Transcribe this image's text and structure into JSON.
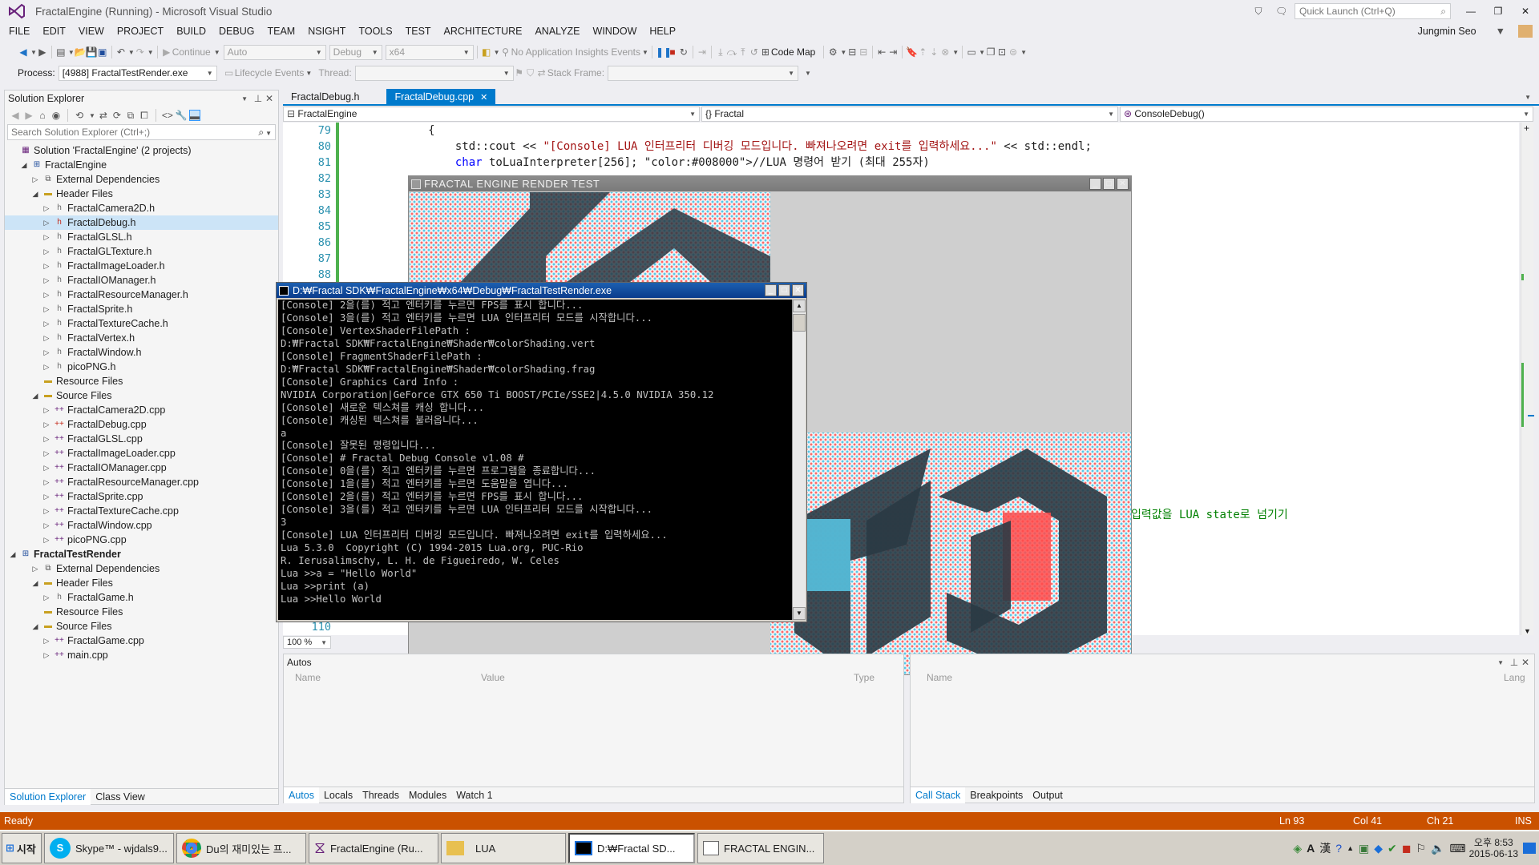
{
  "titlebar": {
    "title": "FractalEngine (Running) - Microsoft Visual Studio",
    "quick_launch": "Quick Launch (Ctrl+Q)",
    "user": "Jungmin Seo"
  },
  "menu": [
    "FILE",
    "EDIT",
    "VIEW",
    "PROJECT",
    "BUILD",
    "DEBUG",
    "TEAM",
    "NSIGHT",
    "TOOLS",
    "TEST",
    "ARCHITECTURE",
    "ANALYZE",
    "WINDOW",
    "HELP"
  ],
  "toolbar": {
    "continue": "Continue",
    "auto": "Auto",
    "config": "Debug",
    "platform": "x64",
    "insights": "No Application Insights Events",
    "code_map": "Code Map"
  },
  "toolbar2": {
    "process_label": "Process:",
    "process_value": "[4988] FractalTestRender.exe",
    "lifecycle": "Lifecycle Events",
    "thread_label": "Thread:",
    "stack_label": "Stack Frame:"
  },
  "solution_explorer": {
    "title": "Solution Explorer",
    "search_placeholder": "Search Solution Explorer (Ctrl+;)",
    "items": [
      {
        "t": "Solution 'FractalEngine' (2 projects)",
        "lvl": 0,
        "tri": "",
        "icon": "solution"
      },
      {
        "t": "FractalEngine",
        "lvl": 1,
        "tri": "◢",
        "icon": "project"
      },
      {
        "t": "External Dependencies",
        "lvl": 2,
        "tri": "▷",
        "icon": "deps"
      },
      {
        "t": "Header Files",
        "lvl": 2,
        "tri": "◢",
        "icon": "folder"
      },
      {
        "t": "FractalCamera2D.h",
        "lvl": 3,
        "tri": "▷",
        "icon": "h"
      },
      {
        "t": "FractalDebug.h",
        "lvl": 3,
        "tri": "▷",
        "icon": "h-edit",
        "sel": true
      },
      {
        "t": "FractalGLSL.h",
        "lvl": 3,
        "tri": "▷",
        "icon": "h"
      },
      {
        "t": "FractalGLTexture.h",
        "lvl": 3,
        "tri": "▷",
        "icon": "h"
      },
      {
        "t": "FractalImageLoader.h",
        "lvl": 3,
        "tri": "▷",
        "icon": "h"
      },
      {
        "t": "FractalIOManager.h",
        "lvl": 3,
        "tri": "▷",
        "icon": "h"
      },
      {
        "t": "FractalResourceManager.h",
        "lvl": 3,
        "tri": "▷",
        "icon": "h"
      },
      {
        "t": "FractalSprite.h",
        "lvl": 3,
        "tri": "▷",
        "icon": "h"
      },
      {
        "t": "FractalTextureCache.h",
        "lvl": 3,
        "tri": "▷",
        "icon": "h"
      },
      {
        "t": "FractalVertex.h",
        "lvl": 3,
        "tri": "▷",
        "icon": "h"
      },
      {
        "t": "FractalWindow.h",
        "lvl": 3,
        "tri": "▷",
        "icon": "h"
      },
      {
        "t": "picoPNG.h",
        "lvl": 3,
        "tri": "▷",
        "icon": "h"
      },
      {
        "t": "Resource Files",
        "lvl": 2,
        "tri": "",
        "icon": "folder"
      },
      {
        "t": "Source Files",
        "lvl": 2,
        "tri": "◢",
        "icon": "folder"
      },
      {
        "t": "FractalCamera2D.cpp",
        "lvl": 3,
        "tri": "▷",
        "icon": "cpp"
      },
      {
        "t": "FractalDebug.cpp",
        "lvl": 3,
        "tri": "▷",
        "icon": "cpp-edit"
      },
      {
        "t": "FractalGLSL.cpp",
        "lvl": 3,
        "tri": "▷",
        "icon": "cpp"
      },
      {
        "t": "FractalImageLoader.cpp",
        "lvl": 3,
        "tri": "▷",
        "icon": "cpp"
      },
      {
        "t": "FractalIOManager.cpp",
        "lvl": 3,
        "tri": "▷",
        "icon": "cpp"
      },
      {
        "t": "FractalResourceManager.cpp",
        "lvl": 3,
        "tri": "▷",
        "icon": "cpp"
      },
      {
        "t": "FractalSprite.cpp",
        "lvl": 3,
        "tri": "▷",
        "icon": "cpp"
      },
      {
        "t": "FractalTextureCache.cpp",
        "lvl": 3,
        "tri": "▷",
        "icon": "cpp"
      },
      {
        "t": "FractalWindow.cpp",
        "lvl": 3,
        "tri": "▷",
        "icon": "cpp"
      },
      {
        "t": "picoPNG.cpp",
        "lvl": 3,
        "tri": "▷",
        "icon": "cpp"
      },
      {
        "t": "FractalTestRender",
        "lvl": 0,
        "tri": "◢",
        "icon": "project",
        "bold": true
      },
      {
        "t": "External Dependencies",
        "lvl": 2,
        "tri": "▷",
        "icon": "deps"
      },
      {
        "t": "Header Files",
        "lvl": 2,
        "tri": "◢",
        "icon": "folder"
      },
      {
        "t": "FractalGame.h",
        "lvl": 3,
        "tri": "▷",
        "icon": "h"
      },
      {
        "t": "Resource Files",
        "lvl": 2,
        "tri": "",
        "icon": "folder"
      },
      {
        "t": "Source Files",
        "lvl": 2,
        "tri": "◢",
        "icon": "folder"
      },
      {
        "t": "FractalGame.cpp",
        "lvl": 3,
        "tri": "▷",
        "icon": "cpp"
      },
      {
        "t": "main.cpp",
        "lvl": 3,
        "tri": "▷",
        "icon": "cpp"
      }
    ],
    "bottom_tabs": [
      "Solution Explorer",
      "Class View"
    ]
  },
  "editor": {
    "tabs": [
      {
        "label": "FractalDebug.h",
        "active": false
      },
      {
        "label": "FractalDebug.cpp",
        "active": true
      }
    ],
    "nav": {
      "project": "FractalEngine",
      "scope": "{} Fractal",
      "member": "ConsoleDebug()"
    },
    "lines": [
      {
        "n": "79",
        "indent": "            ",
        "text": "{"
      },
      {
        "n": "80",
        "indent": "                ",
        "text": "std::cout << \"[Console] LUA 인터프리터 디버깅 모드입니다. 빠져나오려면 exit를 입력하세요...\" << std::endl;"
      },
      {
        "n": "81",
        "indent": "                ",
        "text": "char toLuaInterpreter[256]; //LUA 명령어 받기 (최대 255자)"
      },
      {
        "n": "82",
        "indent": "",
        "text": ""
      },
      {
        "n": "83",
        "indent": "",
        "text": ""
      },
      {
        "n": "84",
        "indent": "",
        "text": ""
      },
      {
        "n": "85",
        "indent": "",
        "text": ""
      },
      {
        "n": "86",
        "indent": "",
        "text": ""
      },
      {
        "n": "87",
        "indent": "",
        "text": ""
      },
      {
        "n": "88",
        "indent": "",
        "text": ""
      }
    ],
    "hidden_line_end": "입력값을 LUA state로 넘기기",
    "last_line_num": "110",
    "zoom": "100 %"
  },
  "render_window": {
    "title": "FRACTAL ENGINE RENDER TEST"
  },
  "console_window": {
    "title": "D:₩Fractal SDK₩FractalEngine₩x64₩Debug₩FractalTestRender.exe",
    "lines": [
      "[Console] 2을(를) 적고 엔터키를 누르면 FPS를 표시 합니다...",
      "[Console] 3을(를) 적고 엔터키를 누르면 LUA 인터프리터 모드를 시작합니다...",
      "[Console] VertexShaderFilePath :",
      "D:₩Fractal SDK₩FractalEngine₩Shader₩colorShading.vert",
      "[Console] FragmentShaderFilePath :",
      "D:₩Fractal SDK₩FractalEngine₩Shader₩colorShading.frag",
      "[Console] Graphics Card Info :",
      "NVIDIA Corporation|GeForce GTX 650 Ti BOOST/PCIe/SSE2|4.5.0 NVIDIA 350.12",
      "[Console] 새로운 텍스쳐를 캐싱 합니다...",
      "[Console] 캐싱된 텍스쳐를 불러옵니다...",
      "a",
      "[Console] 잘못된 명령입니다...",
      "[Console] # Fractal Debug Console v1.08 #",
      "[Console] 0을(를) 적고 엔터키를 누르면 프로그램을 종료합니다...",
      "[Console] 1을(를) 적고 엔터키를 누르면 도움말을 엽니다...",
      "[Console] 2을(를) 적고 엔터키를 누르면 FPS를 표시 합니다...",
      "[Console] 3을(를) 적고 엔터키를 누르면 LUA 인터프리터 모드를 시작합니다...",
      "3",
      "[Console] LUA 인터프리터 디버깅 모드입니다. 빠져나오려면 exit를 입력하세요...",
      "Lua 5.3.0  Copyright (C) 1994-2015 Lua.org, PUC-Rio",
      "R. Ierusalimschy, L. H. de Figueiredo, W. Celes",
      "Lua >>a = \"Hello World\"",
      "Lua >>print (a)",
      "Lua >>Hello World"
    ]
  },
  "autos": {
    "title": "Autos",
    "cols": [
      "Name",
      "Value",
      "Type"
    ],
    "tabs": [
      "Autos",
      "Locals",
      "Threads",
      "Modules",
      "Watch 1"
    ]
  },
  "callstack": {
    "cols": [
      "Name",
      "Lang"
    ],
    "tabs": [
      "Call Stack",
      "Breakpoints",
      "Output"
    ]
  },
  "status": {
    "text": "Ready",
    "ln": "Ln 93",
    "col": "Col 41",
    "ch": "Ch 21",
    "mode": "INS"
  },
  "taskbar": {
    "start": "시작",
    "tasks": [
      "Skype™ - wjdals9...",
      "Du의 재미있는 프...",
      "FractalEngine (Ru...",
      "LUA",
      "D:₩Fractal SD...",
      "FRACTAL ENGIN..."
    ],
    "clock_time": "오후 8:53",
    "clock_date": "2015-06-13",
    "ime": [
      "A",
      "漢"
    ]
  },
  "colors": {
    "status": "#ca5100",
    "accent": "#007acc",
    "keyword": "#0000ff",
    "string": "#a31515",
    "comment": "#008000"
  }
}
